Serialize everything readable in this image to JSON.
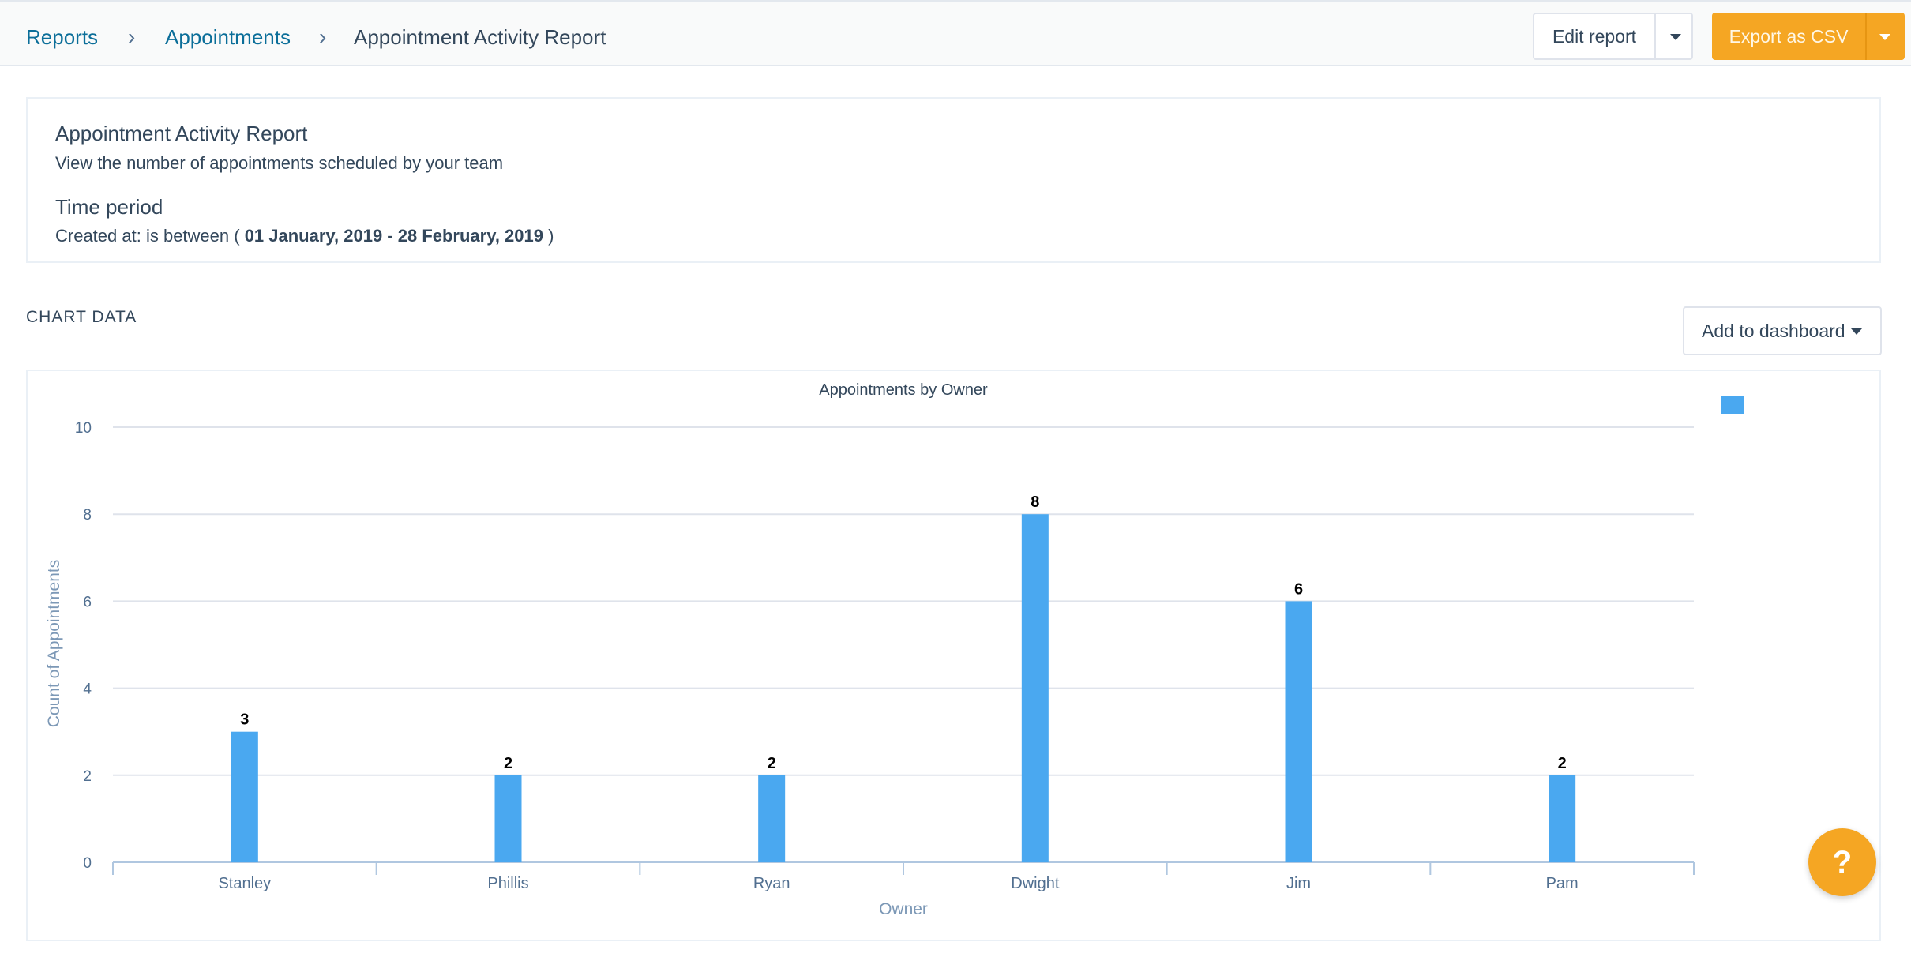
{
  "breadcrumb": {
    "items": [
      "Reports",
      "Appointments"
    ],
    "current": "Appointment Activity Report"
  },
  "toolbar": {
    "edit_label": "Edit report",
    "export_label": "Export as CSV"
  },
  "summary": {
    "title": "Appointment Activity Report",
    "description": "View the number of appointments scheduled by your team",
    "period_heading": "Time period",
    "created_prefix": "Created at: is between ( ",
    "date_range": "01 January, 2019 - 28 February, 2019",
    "created_suffix": " )"
  },
  "chart_section": {
    "heading": "CHART DATA",
    "add_to_dashboard_label": "Add to dashboard"
  },
  "help": {
    "label": "?"
  },
  "colors": {
    "bar": "#4aa8f0",
    "accent": "#f5a623",
    "link": "#0b6e99"
  },
  "chart_data": {
    "type": "bar",
    "title": "Appointments by Owner",
    "xlabel": "Owner",
    "ylabel": "Count of Appointments",
    "categories": [
      "Stanley",
      "Phillis",
      "Ryan",
      "Dwight",
      "Jim",
      "Pam"
    ],
    "values": [
      3,
      2,
      2,
      8,
      6,
      2
    ],
    "ylim": [
      0,
      10
    ],
    "yticks": [
      0,
      2,
      4,
      6,
      8,
      10
    ],
    "grid": true,
    "legend_position": "top-right"
  }
}
